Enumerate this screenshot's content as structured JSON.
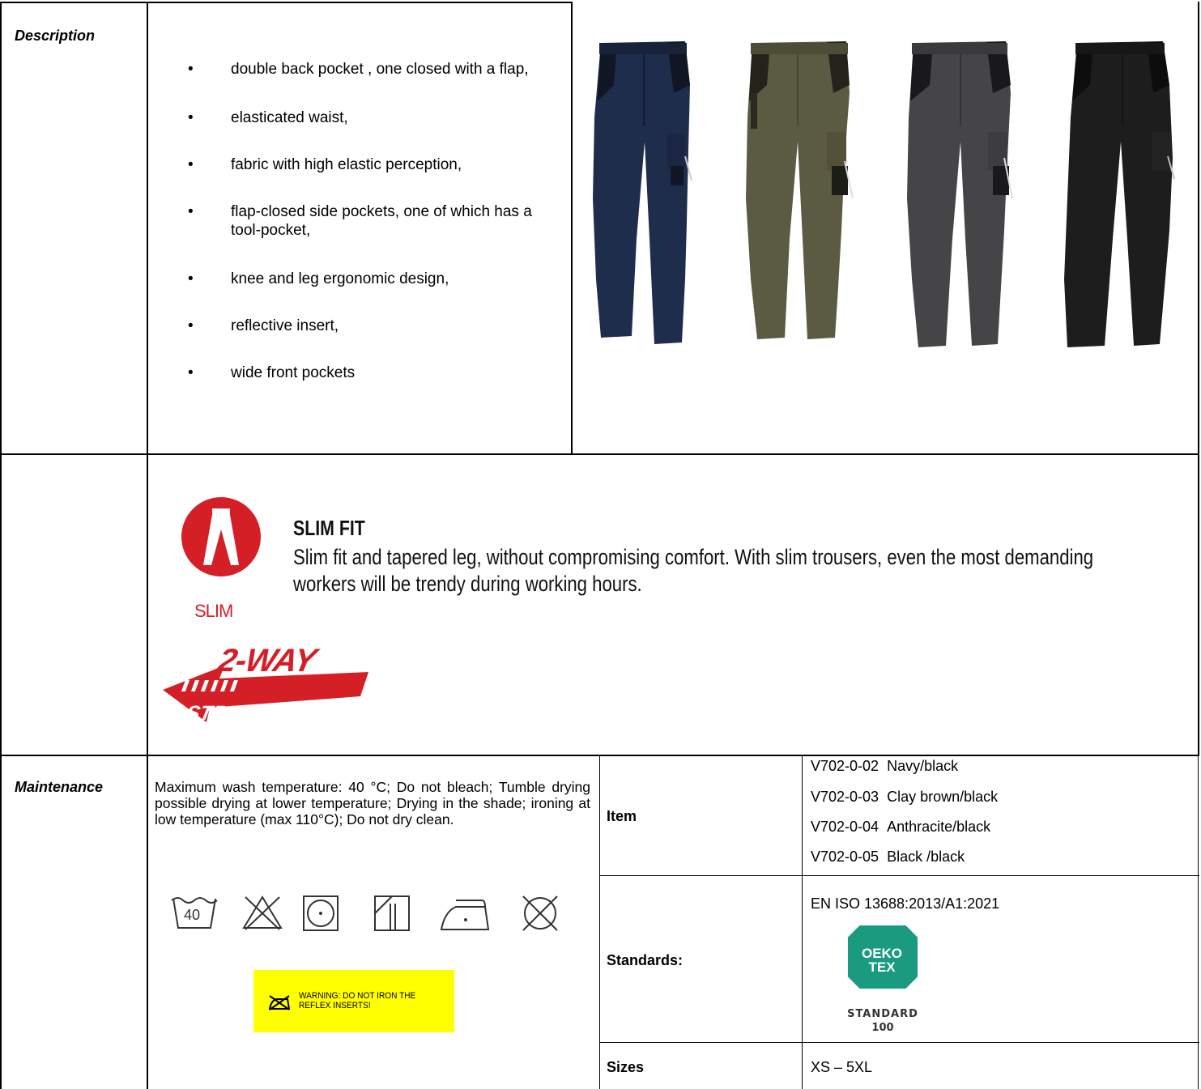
{
  "description": {
    "label": "Description",
    "bullets": [
      "double back pocket , one closed with a flap,",
      "elasticated waist,",
      "fabric with high elastic perception,",
      "flap-closed side pockets, one of which has a tool-pocket,",
      "knee and leg ergonomic design,",
      "reflective insert,",
      "wide front pockets"
    ]
  },
  "product_images": [
    {
      "icon": "trousers-navy-black",
      "color": "#1f2d4d"
    },
    {
      "icon": "trousers-clay-brown-black",
      "color": "#5b5a42"
    },
    {
      "icon": "trousers-anthracite-black",
      "color": "#454548"
    },
    {
      "icon": "trousers-black-black",
      "color": "#1d1d1d"
    }
  ],
  "features": {
    "slim_badge_text": "SLIM",
    "slim_title": "SLIM FIT",
    "slim_description": "Slim fit and tapered leg, without compromising comfort. With slim trousers, even the most demanding workers will be trendy during working hours.",
    "stretch_logo_line1": "2-WAY",
    "stretch_logo_line2": "STRETCH",
    "accent_color": "#d51f26"
  },
  "maintenance": {
    "label": "Maintenance",
    "text": "Maximum wash temperature: 40 °C; Do not bleach; Tumble drying possible drying at lower temperature; Drying in the shade; ironing at low temperature (max 110°C); Do not dry clean.",
    "wash_temp": "40",
    "care_icons": [
      "wash-40-icon",
      "no-bleach-icon",
      "tumble-dry-low-icon",
      "dry-in-shade-icon",
      "iron-low-icon",
      "no-dry-clean-icon"
    ],
    "warning_text_line1": "WARNING: DO NOT IRON THE",
    "warning_text_line2": "REFLEX INSERTS!",
    "warning_color": "#ffff00"
  },
  "specs": {
    "item_label": "Item",
    "items": [
      {
        "code": "V702-0-02",
        "color": "Navy/black"
      },
      {
        "code": "V702-0-03",
        "color": "Clay brown/black"
      },
      {
        "code": "V702-0-04",
        "color": "Anthracite/black"
      },
      {
        "code": "V702-0-05",
        "color": "Black /black"
      }
    ],
    "standards_label": "Standards:",
    "standard": "EN ISO 13688:2013/A1:2021",
    "oeko_line1": "OEKO",
    "oeko_line2": "TEX",
    "oeko_line3": "STANDARD",
    "oeko_line4": "100",
    "oeko_color": "#1a9a7e",
    "sizes_label": "Sizes",
    "sizes": "XS – 5XL"
  }
}
